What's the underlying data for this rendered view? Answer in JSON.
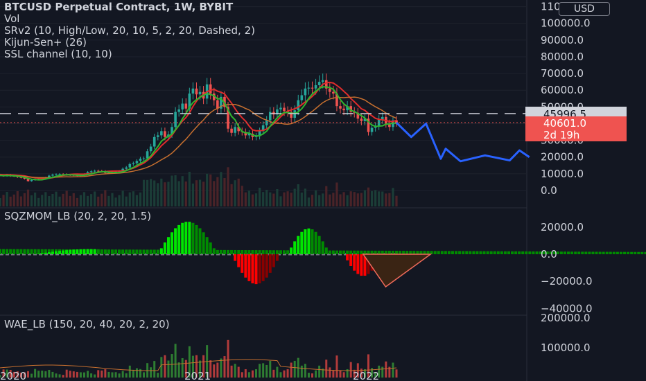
{
  "legend": {
    "title": "BTCUSD Perpetual Contract, 1W, BYBIT",
    "vol": "Vol",
    "srv2": "SRv2 (10, High/Low, 20, 10, 5, 2, 20, Dashed, 2)",
    "kijun": "Kijun-Sen+ (26)",
    "ssl": "SSL channel (10, 10)",
    "sqzmom": "SQZMOM_LB (20, 2, 20, 1.5)",
    "wae": "WAE_LB (150, 20, 40, 20, 2, 20)"
  },
  "currency_button": "USD",
  "colors": {
    "background": "#131722",
    "up_candle": "#26a69a",
    "down_candle": "#ef5350",
    "kijun": "#e02c2c",
    "ssl_green": "#2fb52f",
    "ssl_brown": "#c8702f",
    "projection": "#2962ff",
    "sqz_bright_green": "#00e600",
    "sqz_dark_green": "#008c00",
    "sqz_red": "#ff0000",
    "sqz_dark_red": "#8b0000",
    "price_tag_red": "#ef5350",
    "price_tag_gray": "#d1d4dc"
  },
  "chart_data": [
    {
      "type": "candlestick",
      "title": "BTCUSD Perpetual Contract, 1W, BYBIT",
      "x_ticks": [
        "2020",
        "2021",
        "2022"
      ],
      "y_ticks": [
        "0.0",
        "10000.0",
        "20000.0",
        "30000.0",
        "40000.0",
        "50000.0",
        "60000.0",
        "70000.0",
        "80000.0",
        "90000.0",
        "100000.0",
        "110000.0"
      ],
      "ylim": [
        0,
        115000
      ],
      "weekly_close": [
        9200,
        8800,
        9400,
        8700,
        8600,
        8000,
        7700,
        7000,
        5600,
        6200,
        6800,
        6900,
        7300,
        7700,
        8900,
        9500,
        9700,
        9800,
        9700,
        9400,
        9300,
        9200,
        9100,
        9300,
        9700,
        11000,
        11500,
        11800,
        11700,
        11500,
        10500,
        10600,
        10800,
        11300,
        11500,
        13000,
        13800,
        15800,
        16300,
        17700,
        19000,
        19200,
        23500,
        26300,
        32000,
        33000,
        35500,
        32000,
        33500,
        38000,
        47000,
        48500,
        52000,
        49000,
        58000,
        61000,
        57500,
        59000,
        55000,
        63500,
        58000,
        54000,
        49000,
        56000,
        50000,
        37000,
        34500,
        38000,
        35500,
        35000,
        33000,
        34000,
        32000,
        32500,
        35500,
        39000,
        42000,
        47000,
        45500,
        48500,
        49500,
        47500,
        47000,
        43500,
        48000,
        54000,
        57000,
        61000,
        61500,
        61000,
        63000,
        65000,
        66000,
        61000,
        59000,
        58000,
        50500,
        49000,
        48000,
        50500,
        47000,
        46500,
        43000,
        41500,
        43000,
        35000,
        37500,
        38500,
        42500,
        44000,
        40000,
        38000,
        42000,
        40601
      ],
      "horizontal_line": "45996.5",
      "last_price": "40601.0",
      "countdown": "2d 19h",
      "projection": [
        [
          40601,
          0
        ],
        [
          32000,
          3
        ],
        [
          40000,
          6
        ],
        [
          19000,
          9
        ],
        [
          25000,
          10
        ],
        [
          17500,
          13
        ],
        [
          21000,
          18
        ],
        [
          18000,
          23
        ],
        [
          24000,
          25
        ],
        [
          20000,
          27
        ]
      ]
    },
    {
      "type": "bar",
      "title": "SQZMOM_LB (20, 2, 20, 1.5)",
      "y_ticks": [
        "20000.0",
        "0.0",
        "−20000.0",
        "−40000.0"
      ],
      "ylim": [
        -48000,
        30000
      ],
      "segments": [
        {
          "from": -800,
          "to": 300,
          "peak": 5000,
          "color": "green"
        },
        {
          "from": 10,
          "to": 41,
          "peak": 3800,
          "color": "green"
        },
        {
          "from": 45,
          "to": 62,
          "peak": 24000,
          "color": "green"
        },
        {
          "from": 66,
          "to": 80,
          "peak": -22000,
          "color": "red"
        },
        {
          "from": 82,
          "to": 94,
          "peak": 19000,
          "color": "green"
        },
        {
          "from": 98,
          "to": 109,
          "peak": -16000,
          "color": "red"
        }
      ],
      "projection_polygon": [
        [
          0,
          0
        ],
        [
          -24000,
          4
        ],
        [
          0,
          12
        ]
      ]
    },
    {
      "type": "bar",
      "title": "WAE_LB (150, 20, 40, 20, 2, 20)",
      "y_ticks": [
        "200000.0",
        "100000.0"
      ],
      "ylim": [
        0,
        210000
      ]
    }
  ]
}
